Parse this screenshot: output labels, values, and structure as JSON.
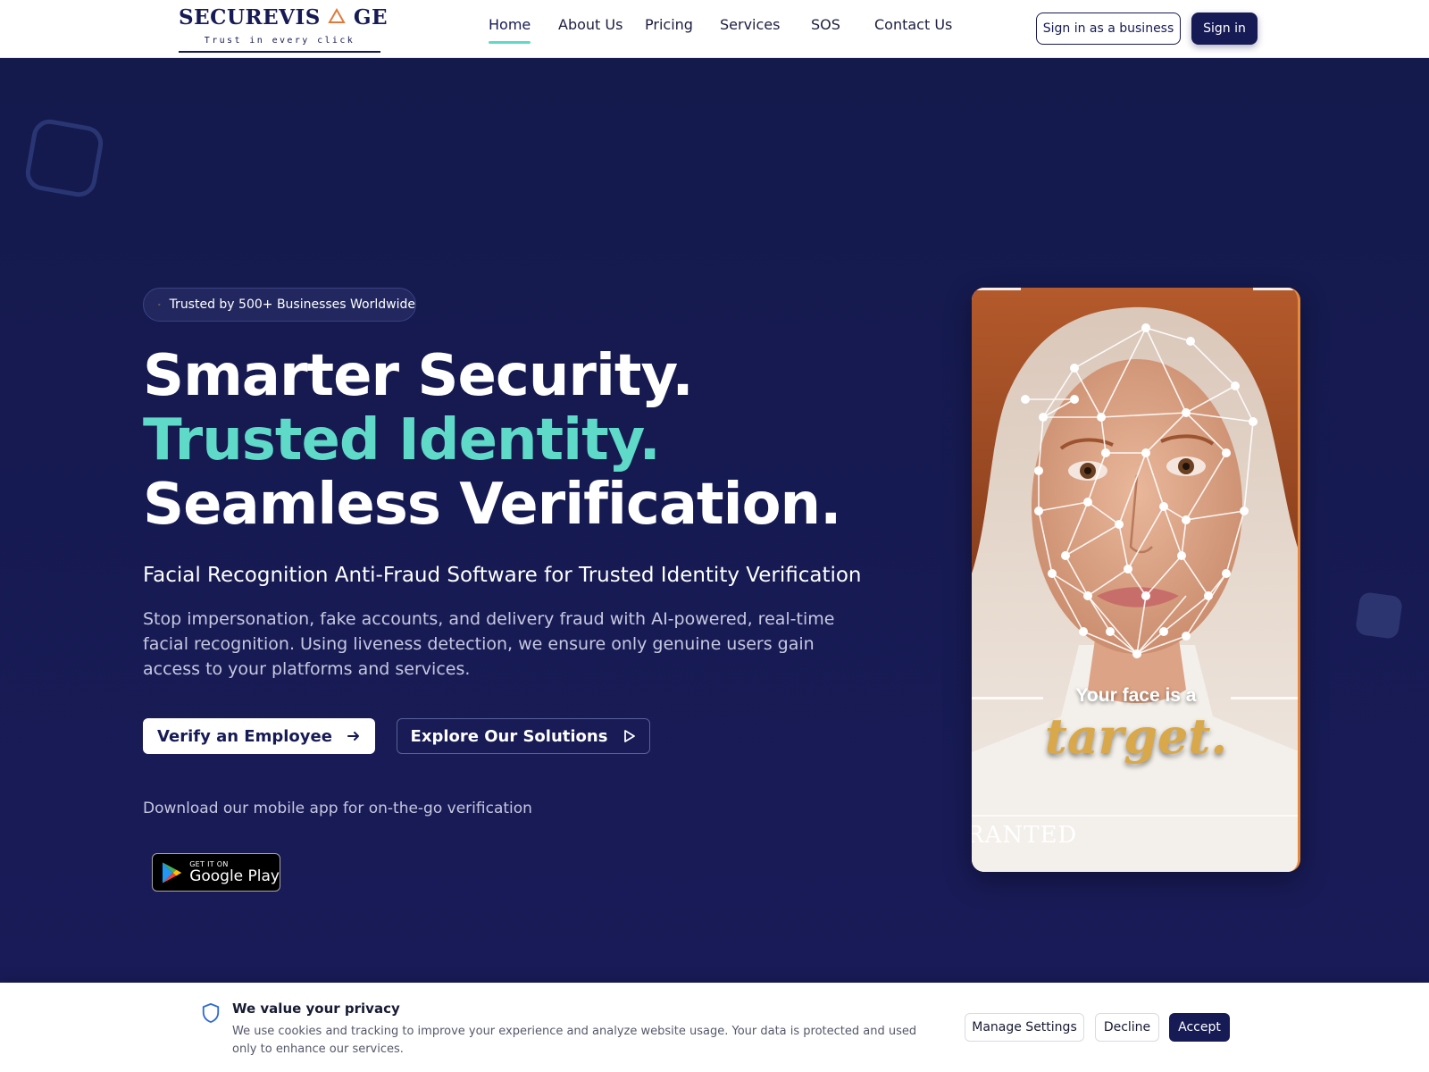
{
  "brand": {
    "name_part1": "SECUREVIS",
    "name_part2": "GE",
    "tagline": "Trust in every click",
    "triangle_color": "#e07a3c"
  },
  "nav": {
    "links": [
      {
        "label": "Home",
        "active": true
      },
      {
        "label": "About Us",
        "active": false
      },
      {
        "label": "Pricing",
        "active": false
      },
      {
        "label": "Services",
        "active": false
      },
      {
        "label": "SOS",
        "active": false
      },
      {
        "label": "Contact Us",
        "active": false
      }
    ],
    "business_signin_label": "Sign in as a business",
    "signin_label": "Sign in"
  },
  "hero": {
    "badge_icon": "star-icon",
    "badge_text": "Trusted by 500+ Businesses Worldwide",
    "headline": {
      "part1": "Smarter Security. ",
      "accent": "Trusted Identity.",
      "part2": " Seamless Verification."
    },
    "subheading": "Facial Recognition Anti-Fraud Software for Trusted Identity Verification",
    "description": "Stop impersonation, fake accounts, and delivery fraud with AI-powered, real-time facial recognition. Using liveness detection, we ensure only genuine users gain access to your platforms and services.",
    "primary_button": {
      "label": "Verify an Employee",
      "icon": "arrow-right-icon"
    },
    "secondary_button": {
      "label": "Explore Our Solutions",
      "icon": "play-icon"
    },
    "download_text": "Download our mobile app for on-the-go verification",
    "store_badge": {
      "small": "GET IT ON",
      "big": "Google Play"
    }
  },
  "video": {
    "caption_line1": "Your face is a",
    "caption_line2": "target.",
    "caption_bottom": "RANTED"
  },
  "cookie_banner": {
    "icon": "shield-icon",
    "title": "We value your privacy",
    "text": "We use cookies and tracking to improve your experience and analyze website usage. Your data is protected and used only to enhance our services.",
    "manage_label": "Manage Settings",
    "decline_label": "Decline",
    "accept_label": "Accept"
  },
  "colors": {
    "brand_navy": "#161a55",
    "accent_teal": "#5fd9c8",
    "hero_bg": "#171a52"
  }
}
